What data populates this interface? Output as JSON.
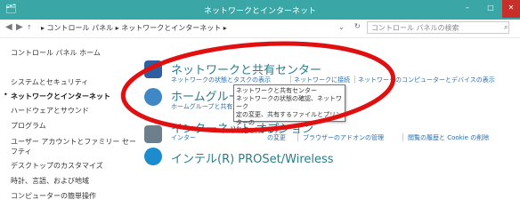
{
  "window": {
    "title": "ネットワークとインターネット",
    "min": "–",
    "max": "□",
    "close": "✕"
  },
  "address_bar": {
    "breadcrumbs": "▸ コントロール パネル ▸ ネットワークとインターネット ▸",
    "search_placeholder": "コントロール パネルの検索"
  },
  "sidebar": {
    "home": "コントロール パネル ホーム",
    "items": [
      "システムとセキュリティ",
      "ネットワークとインターネット",
      "ハードウェアとサウンド",
      "プログラム",
      "ユーザー アカウントとファミリー セー",
      "フティ",
      "デスクトップのカスタマイズ",
      "時計、言語、および地域",
      "コンピューターの簡単操作"
    ]
  },
  "categories": {
    "network": {
      "title": "ネットワークと共有センター",
      "link1": "ネットワークの状態とタスクの表示",
      "link2": "ネットワークに接続",
      "link3": "ネットワークのコンピューターとデバイスの表示"
    },
    "homegroup": {
      "title": "ホームグループ",
      "link1": "ホームグループと共有"
    },
    "internet": {
      "title": "インターネット オプション",
      "link1": "インター",
      "link2": "の変更",
      "link3": "ブラウザーのアドオンの管理",
      "link4": "閲覧の履歴と Cookie の削除"
    },
    "intel": {
      "title": "インテル(R) PROSet/Wireless"
    }
  },
  "tooltip": {
    "lines": [
      "ネットワークと共有センター",
      "ネットワークの状態の確認、ネットワーク",
      "定の変更、共有するファイルとプリンターの",
      "設定を行います。"
    ]
  },
  "colors": {
    "titlebar": "#3aa6a6",
    "close": "#c7302a",
    "link": "#2a6fb0",
    "annotation": "#e01010"
  }
}
